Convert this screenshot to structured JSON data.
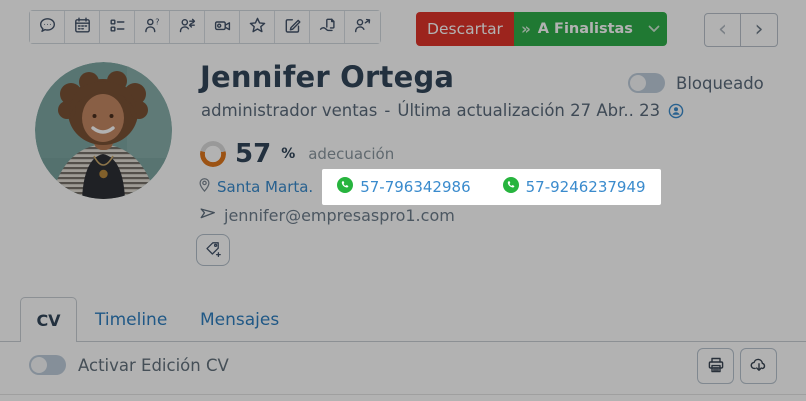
{
  "toolbar": {
    "icons": [
      "chat-icon",
      "calendar-icon",
      "checklist-icon",
      "candidate-question-icon",
      "candidate-share-icon",
      "video-icon",
      "star-icon",
      "edit-icon",
      "document-hand-icon",
      "candidate-export-icon"
    ]
  },
  "actions": {
    "discard_label": "Descartar",
    "finalists_label": "A Finalistas",
    "finalists_prefix_icon": "»",
    "finalists_caret_icon": "⌄"
  },
  "pager": {
    "prev_icon": "‹",
    "next_icon": "›"
  },
  "profile": {
    "name": "Jennifer Ortega",
    "role": "administrador ventas",
    "separator": "-",
    "last_update": "Última actualización 27 Abr.. 23",
    "match": {
      "value": "57",
      "unit": "%",
      "label": "adecuación"
    },
    "location": "Santa Marta.",
    "phones": [
      {
        "number": "57-796342986"
      },
      {
        "number": "57-9246237949"
      }
    ],
    "email": "jennifer@empresaspro1.com"
  },
  "blocked_toggle": {
    "label": "Bloqueado",
    "state": "off"
  },
  "tabs": [
    {
      "label": "CV",
      "active": true
    },
    {
      "label": "Timeline",
      "active": false
    },
    {
      "label": "Mensajes",
      "active": false
    }
  ],
  "cv_toolbar": {
    "edit_toggle_label": "Activar Edición CV",
    "edit_toggle_state": "off"
  },
  "colors": {
    "discard_red": "#e0342a",
    "finalists_green": "#2eae4a",
    "link_blue": "#3a8bcd",
    "whatsapp_green": "#27b43e",
    "match_orange": "#e0771e",
    "text_dark": "#33475b",
    "dim_overlay": "rgba(0,0,0,0.30)"
  }
}
